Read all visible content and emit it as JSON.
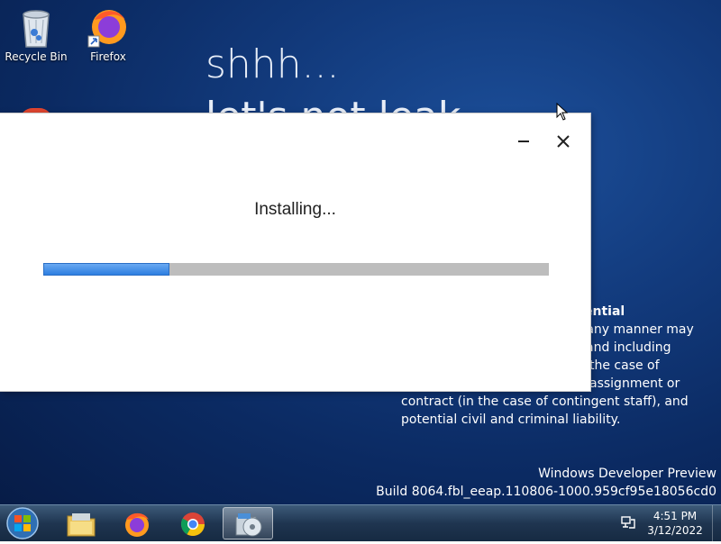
{
  "desktop": {
    "icons": [
      {
        "label": "Recycle Bin",
        "icon": "recycle-bin-icon"
      },
      {
        "label": "Firefox",
        "icon": "firefox-icon"
      }
    ],
    "wallpaper_line1": "shhh...",
    "wallpaper_line2": "let's not leak",
    "confidential_title": "ential",
    "confidential_lines": [
      "n any manner may",
      "o and including",
      "the case of",
      "assignment or",
      "contract (in the case of contingent staff), and",
      "potential civil and criminal liability."
    ],
    "build_line1": "Windows Developer Preview",
    "build_line2": "Build 8064.fbl_eeap.110806-1000.959cf95e18056cd0"
  },
  "installer": {
    "status": "Installing...",
    "progress": 0.25,
    "accent": "#2d7ee0"
  },
  "taskbar": {
    "items": [
      {
        "icon": "file-explorer-icon"
      },
      {
        "icon": "firefox-icon"
      },
      {
        "icon": "chrome-icon"
      },
      {
        "icon": "installer-icon",
        "active": true
      }
    ],
    "clock_time": "4:51 PM",
    "clock_date": "3/12/2022"
  }
}
